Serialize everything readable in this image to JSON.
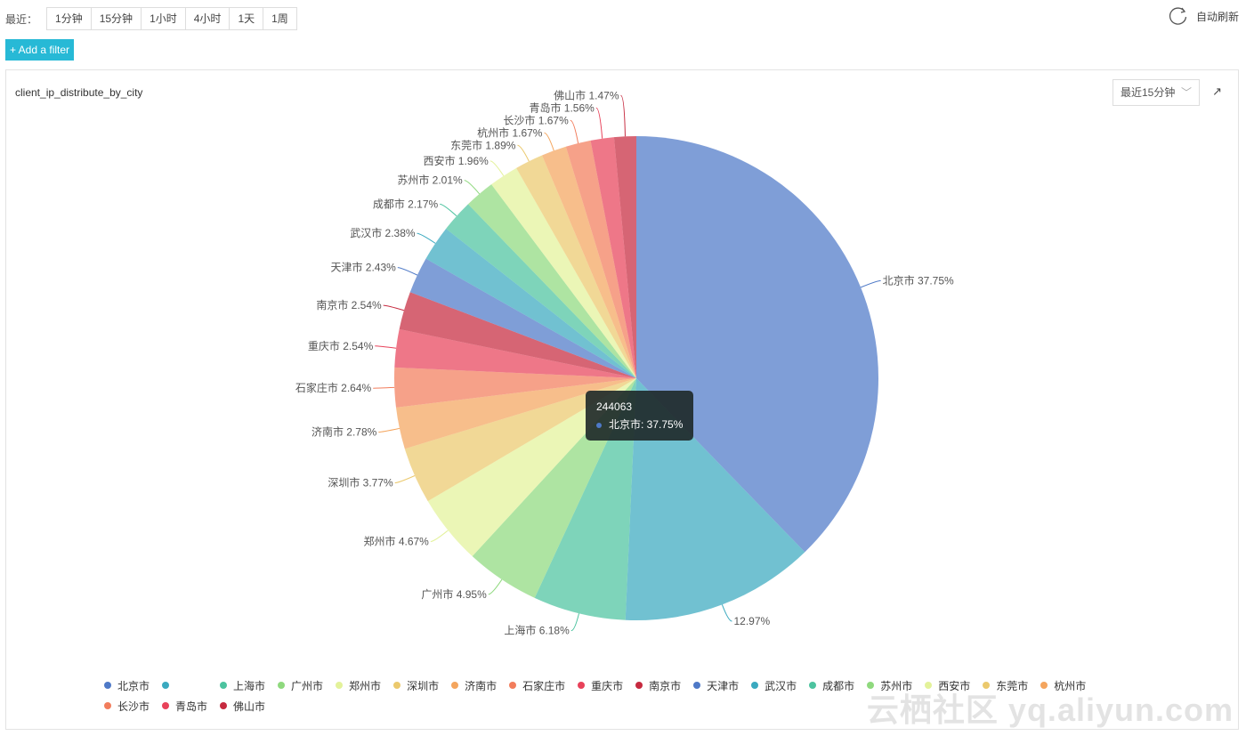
{
  "toolbar": {
    "range_label": "最近：",
    "ranges": [
      "1分钟",
      "15分钟",
      "1小时",
      "4小时",
      "1天",
      "1周"
    ],
    "auto_refresh": "自动刷新",
    "add_filter": "+ Add a filter"
  },
  "panel": {
    "title": "client_ip_distribute_by_city",
    "time_select": "最近15分钟",
    "expand_icon": "arrow-up-right-icon"
  },
  "tooltip": {
    "value": "244063",
    "label": "北京市: 37.75%"
  },
  "watermark": "云栖社区 yq.aliyun.com",
  "chart_data": {
    "type": "pie",
    "title": "client_ip_distribute_by_city",
    "legend_position": "bottom",
    "categories": [
      "北京市",
      "",
      "上海市",
      "广州市",
      "郑州市",
      "深圳市",
      "济南市",
      "石家庄市",
      "重庆市",
      "南京市",
      "天津市",
      "武汉市",
      "成都市",
      "苏州市",
      "西安市",
      "东莞市",
      "杭州市",
      "长沙市",
      "青岛市",
      "佛山市"
    ],
    "values": [
      37.75,
      12.97,
      6.18,
      4.95,
      4.67,
      3.77,
      2.78,
      2.64,
      2.54,
      2.54,
      2.43,
      2.38,
      2.17,
      2.01,
      1.96,
      1.89,
      1.67,
      1.67,
      1.56,
      1.47
    ],
    "labels": [
      "北京市 37.75%",
      "12.97%",
      "上海市 6.18%",
      "广州市 4.95%",
      "郑州市 4.67%",
      "深圳市 3.77%",
      "济南市 2.78%",
      "石家庄市 2.64%",
      "重庆市 2.54%",
      "南京市 2.54%",
      "天津市 2.43%",
      "武汉市 2.38%",
      "成都市 2.17%",
      "苏州市 2.01%",
      "西安市 1.96%",
      "东莞市 1.89%",
      "杭州市 1.67%",
      "长沙市 1.67%",
      "青岛市 1.56%",
      "佛山市 1.47%"
    ],
    "colors": [
      "#4e79c7",
      "#3aa9bf",
      "#4cc39f",
      "#8fd97e",
      "#e3f29a",
      "#ebc96d",
      "#f4a55e",
      "#f27d5c",
      "#e8425a",
      "#c62a3f"
    ]
  }
}
